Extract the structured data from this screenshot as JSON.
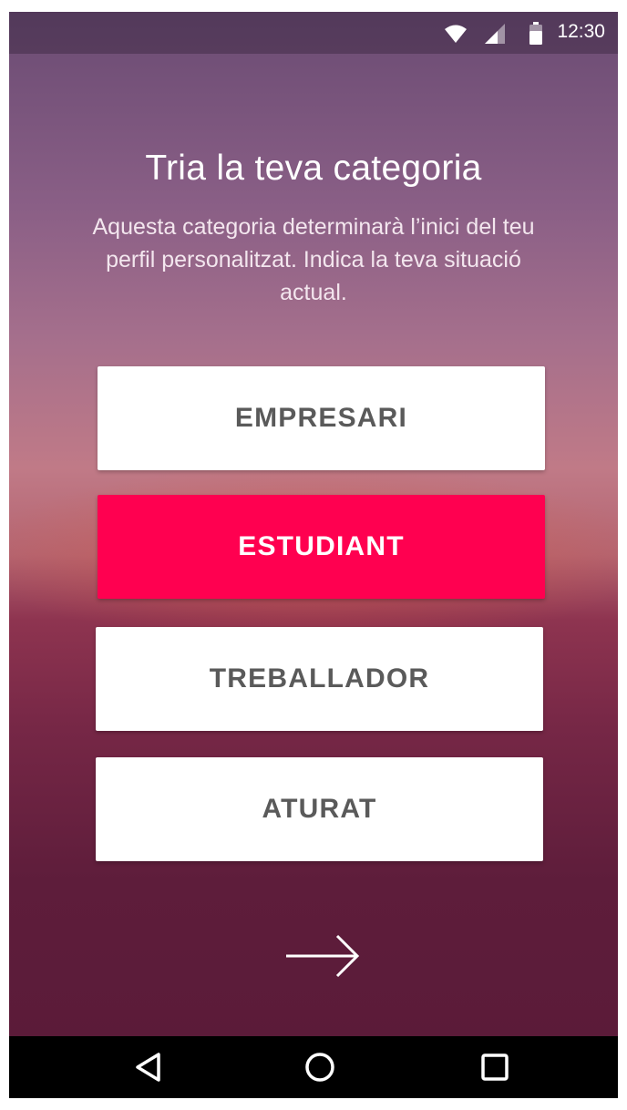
{
  "status_bar": {
    "time": "12:30",
    "icons": [
      "wifi-icon",
      "signal-icon",
      "battery-icon"
    ]
  },
  "screen": {
    "title": "Tria la teva categoria",
    "subtitle": "Aquesta categoria determinarà l’inici del teu perfil personalitzat. Indica la teva situació actual."
  },
  "options": [
    {
      "label": "EMPRESARI",
      "selected": false
    },
    {
      "label": "ESTUDIANT",
      "selected": true
    },
    {
      "label": "TREBALLADOR",
      "selected": false
    },
    {
      "label": "ATURAT",
      "selected": false
    }
  ],
  "next": {
    "icon": "arrow-right-icon"
  },
  "nav_bar": {
    "icons": [
      "back-icon",
      "home-icon",
      "recent-apps-icon"
    ]
  },
  "colors": {
    "accent": "#ff0050",
    "button_bg": "#ffffff",
    "button_text": "#5a5a5a",
    "nav_bar": "#000000"
  }
}
